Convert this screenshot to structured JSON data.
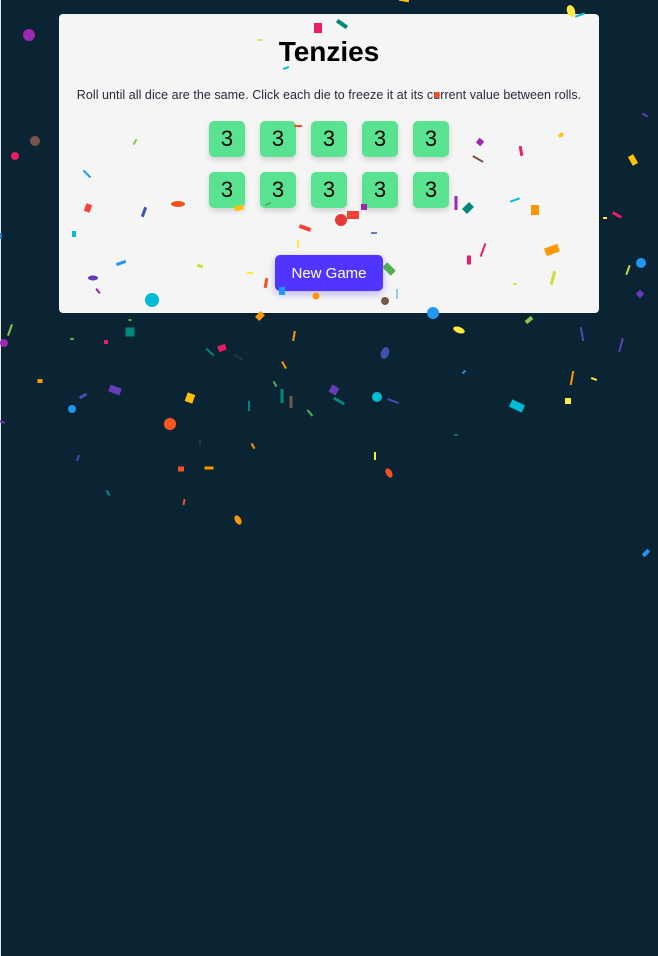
{
  "game": {
    "title": "Tenzies",
    "instructions": "Roll until all dice are the same. Click each die to freeze it at its current value between rolls.",
    "dice": [
      "3",
      "3",
      "3",
      "3",
      "3",
      "3",
      "3",
      "3",
      "3",
      "3"
    ],
    "new_game_label": "New Game"
  },
  "colors": {
    "background": "#0b2434",
    "card": "#f5f5f5",
    "die": "#59e391",
    "button": "#5035ff"
  },
  "icons": [
    "confetti"
  ]
}
